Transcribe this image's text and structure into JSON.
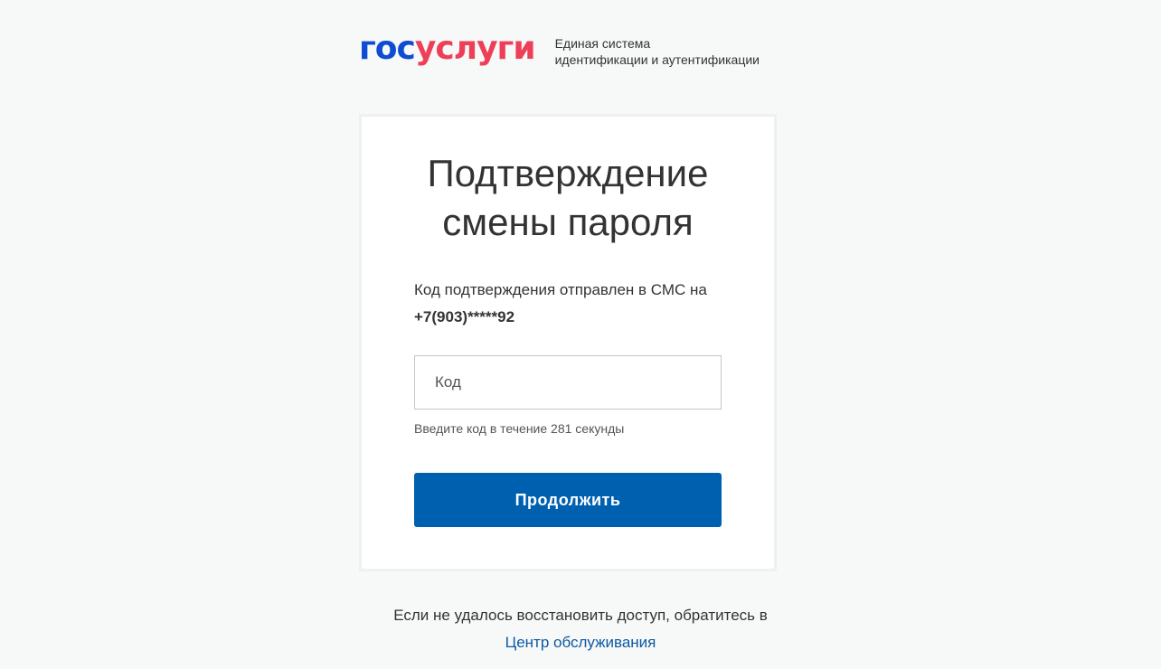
{
  "header": {
    "logo_part1": "гос",
    "logo_part2": "услуги",
    "subtitle_line1": "Единая система",
    "subtitle_line2": "идентификации и аутентификации"
  },
  "card": {
    "title_line1": "Подтверждение",
    "title_line2": "смены пароля",
    "sms_text": "Код подтверждения отправлен в СМС на",
    "phone": "+7(903)*****92",
    "code_input": {
      "placeholder": "Код",
      "value": ""
    },
    "hint": "Введите код в течение 281 секунды",
    "continue_label": "Продолжить"
  },
  "footer": {
    "text": "Если не удалось восстановить доступ, обратитесь в",
    "link": "Центр обслуживания"
  },
  "colors": {
    "logo_blue": "#0d4cd3",
    "logo_red": "#ee3f58",
    "button_blue": "#0060b0",
    "link_blue": "#0b5aa3",
    "background": "#f7f8f8"
  }
}
